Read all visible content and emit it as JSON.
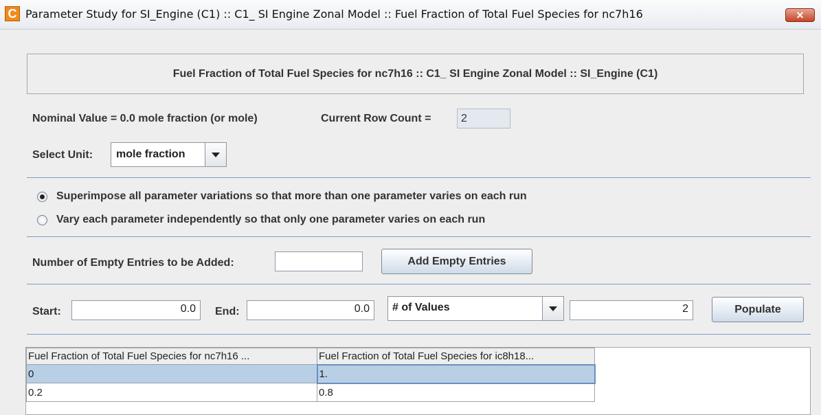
{
  "window": {
    "title": "Parameter Study for SI_Engine (C1) :: C1_ SI Engine Zonal Model :: Fuel Fraction of Total Fuel Species for nc7h16",
    "icon_letter": "C",
    "close_glyph": "✕"
  },
  "heading": "Fuel Fraction of Total Fuel Species for nc7h16 :: C1_ SI Engine Zonal Model :: SI_Engine (C1)",
  "nominal_value": "Nominal Value = 0.0 mole fraction (or mole)",
  "row_count": {
    "label": "Current Row Count =",
    "value": "2"
  },
  "unit": {
    "label": "Select Unit:",
    "selected": "mole fraction"
  },
  "options": {
    "superimpose": "Superimpose all parameter variations so that more than one parameter varies on each run",
    "independent": "Vary each parameter independently so that only one parameter varies on each run",
    "selected": "superimpose"
  },
  "empty_entries": {
    "label": "Number of Empty Entries to be Added:",
    "value": "",
    "button": "Add Empty Entries"
  },
  "range": {
    "start_label": "Start:",
    "start_value": "0.0",
    "end_label": "End:",
    "end_value": "0.0",
    "mode_selected": "# of Values",
    "count_value": "2",
    "populate_button": "Populate"
  },
  "table": {
    "columns": [
      "Fuel Fraction of Total Fuel Species for nc7h16 ...",
      "Fuel Fraction of Total Fuel Species for ic8h18..."
    ],
    "rows": [
      [
        "0",
        "1."
      ],
      [
        "0.2",
        "0.8"
      ]
    ],
    "selected_row": 0
  },
  "colors": {
    "separator": "#7d9bc7",
    "selection": "#b8cfe5",
    "icon": "#f08a1c",
    "close": "#c7442a"
  }
}
